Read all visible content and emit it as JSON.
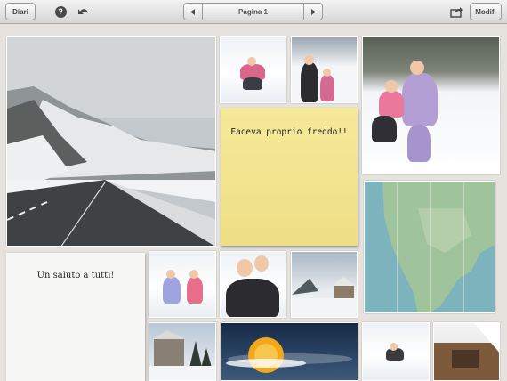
{
  "toolbar": {
    "journals_label": "Diari",
    "help_icon": "question-mark-circle-icon",
    "undo_icon": "undo-arrow-icon",
    "page_label": "Pagina 1",
    "prev_icon": "triangle-left-icon",
    "next_icon": "triangle-right-icon",
    "share_icon": "share-icon",
    "edit_label": "Modif."
  },
  "notes": {
    "yellow_note_text": "Faceva proprio freddo!!",
    "paper_note_text": "Un saluto a tutti!"
  },
  "colors": {
    "note_yellow": "#f3e592",
    "map_water": "#7fb6bf",
    "map_land": "#9ec39a",
    "sun": "#f3a81c"
  }
}
